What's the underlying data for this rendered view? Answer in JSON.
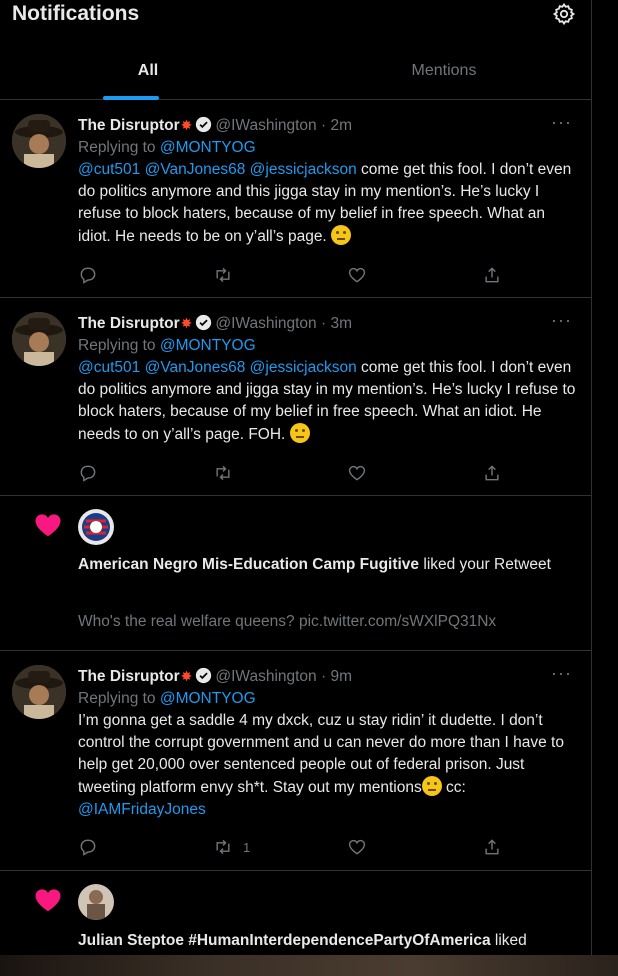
{
  "header": {
    "title": "Notifications",
    "settings_icon": "gear-icon"
  },
  "tabs": [
    {
      "label": "All",
      "active": true
    },
    {
      "label": "Mentions",
      "active": false
    }
  ],
  "accent": "#1d9bf0",
  "like_color": "#f91880",
  "tweets": [
    {
      "name": "The Disruptor",
      "handle": "@IWashington",
      "sep": " · ",
      "time": "2m",
      "replying_label": "Replying to ",
      "replying_to": "@MONTYOG",
      "mentions": "@cut501 @VanJones68 @jessicjackson",
      "text": " come get this fool. I don’t even do politics anymore and this jigga stay in my mention’s. He’s lucky I refuse to block haters, because of my belief in free speech. What an idiot. He needs to be on y’all’s page.",
      "retweets": "",
      "likes": ""
    },
    {
      "name": "The Disruptor",
      "handle": "@IWashington",
      "sep": " · ",
      "time": "3m",
      "replying_label": "Replying to ",
      "replying_to": "@MONTYOG",
      "mentions": "@cut501 @VanJones68 @jessicjackson",
      "text": " come get this fool. I don’t even do politics anymore and jigga stay in my mention’s. He’s lucky I refuse to block haters, because of my belief in free speech. What an idiot. He needs to on y’all’s page. FOH.",
      "retweets": "",
      "likes": ""
    },
    {
      "name": "The Disruptor",
      "handle": "@IWashington",
      "sep": " · ",
      "time": "9m",
      "replying_label": "Replying to ",
      "replying_to": "@MONTYOG",
      "text": "I’m gonna get a saddle 4 my dxck, cuz u stay ridin’ it dudette. I don’t control the corrupt government and u can never do more than I have to help get 20,000 over sentenced people out of federal prison. Just tweeting platform envy sh*t. Stay out my mentions",
      "cc_label": " cc: ",
      "cc_handle": "@IAMFridayJones",
      "retweets": "1",
      "likes": ""
    }
  ],
  "likes": [
    {
      "user": "American Negro Mis-Education Camp Fugitive",
      "action": " liked your Retweet",
      "preview": "Who's the real welfare queens? pic.twitter.com/sWXlPQ31Nx"
    },
    {
      "user": "Julian Steptoe #HumanInterdependencePartyOfAmerica",
      "action": " liked"
    }
  ]
}
